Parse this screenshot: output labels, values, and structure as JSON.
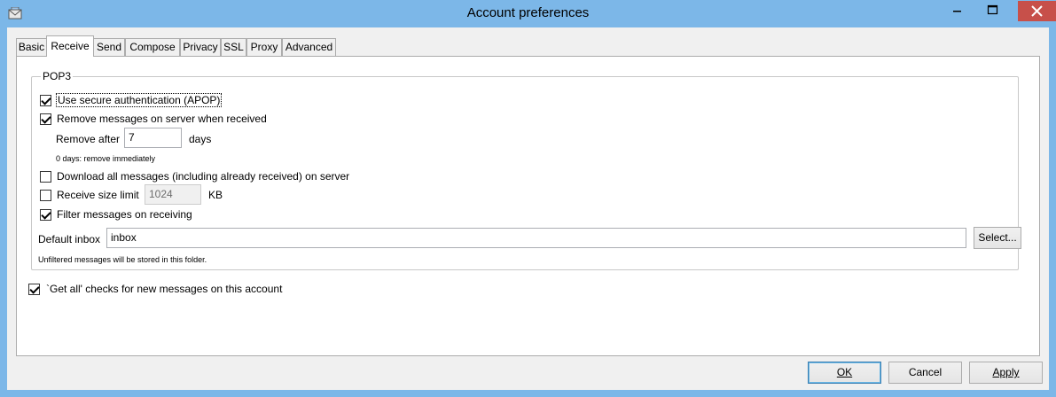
{
  "window": {
    "title": "Account preferences"
  },
  "tabs": [
    {
      "label": "Basic"
    },
    {
      "label": "Receive"
    },
    {
      "label": "Send"
    },
    {
      "label": "Compose"
    },
    {
      "label": "Privacy"
    },
    {
      "label": "SSL"
    },
    {
      "label": "Proxy"
    },
    {
      "label": "Advanced"
    }
  ],
  "active_tab": "Receive",
  "pop3": {
    "legend": "POP3",
    "use_apop": {
      "label": "Use secure authentication (APOP)",
      "checked": true
    },
    "remove_on_server": {
      "label": "Remove messages on server when received",
      "checked": true
    },
    "remove_after": {
      "label": "Remove after",
      "value": "7",
      "unit": "days"
    },
    "remove_hint": "0 days: remove immediately",
    "download_all": {
      "label": "Download all messages (including already received) on server",
      "checked": false
    },
    "size_limit": {
      "label": "Receive size limit",
      "value": "1024",
      "unit": "KB",
      "checked": false
    },
    "filter_on_receive": {
      "label": "Filter messages on receiving",
      "checked": true
    },
    "default_inbox": {
      "label": "Default inbox",
      "value": "inbox",
      "select_label": "Select..."
    },
    "inbox_hint": "Unfiltered messages will be stored in this folder."
  },
  "get_all": {
    "label": "`Get all' checks for new messages on this account",
    "checked": true
  },
  "buttons": {
    "ok": "OK",
    "cancel": "Cancel",
    "apply": "Apply"
  },
  "colors": {
    "titlebar": "#7cb7e8",
    "close": "#c7504a",
    "default_button_border": "#3c7fb1"
  }
}
